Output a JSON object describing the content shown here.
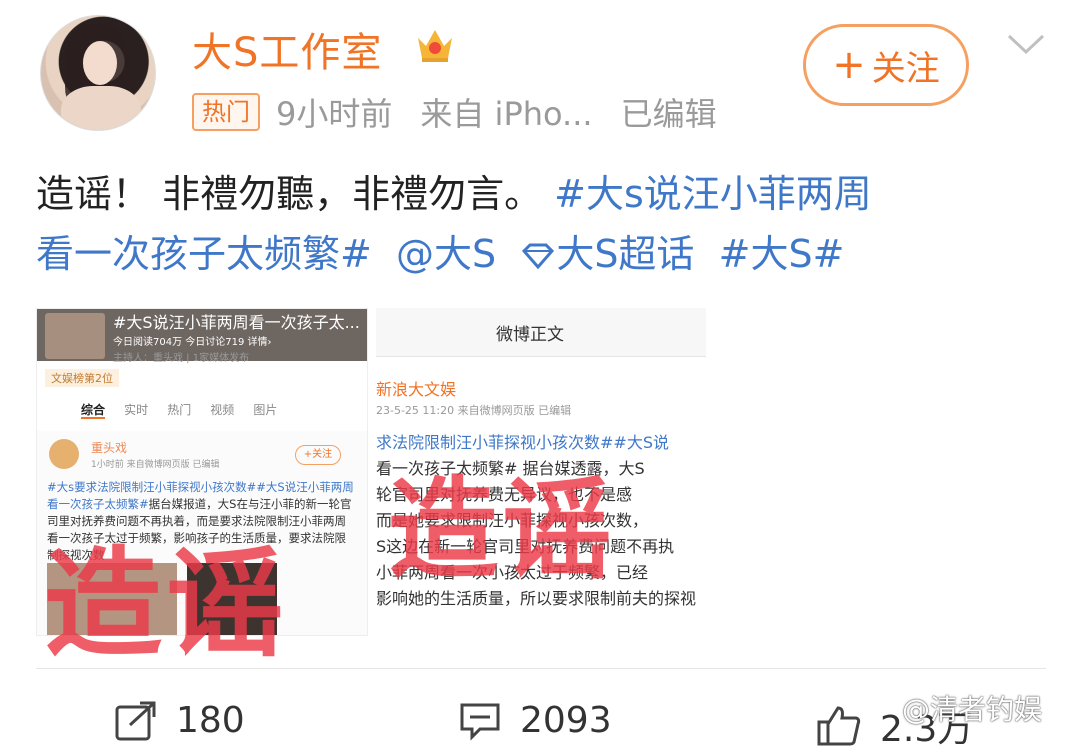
{
  "post": {
    "username": "大S工作室",
    "follow_label": "关注",
    "hot_badge": "热门",
    "time": "9小时前",
    "source": "来自 iPho...",
    "edited": "已编辑",
    "text_plain": "造谣！ 非禮勿聽，非禮勿言。 ",
    "text_tag1_a": "#大s说汪小菲两周",
    "text_tag1_b": "看一次孩子太频繁#",
    "mention": "@大S",
    "supertopic": "大S超话",
    "tag2": "#大S#"
  },
  "image_left": {
    "banner_title": "#大S说汪小菲两周看一次孩子太...",
    "banner_stats": "今日阅读704万  今日讨论719  详情›",
    "host": "主持人：重头戏 | 1家媒体发布",
    "rank": "文娱榜第2位",
    "tabs": [
      "综合",
      "实时",
      "热门",
      "视频",
      "图片"
    ],
    "author": "重头戏",
    "author_meta": "1小时前 来自微博网页版 已编辑",
    "follow": "+关注",
    "body_tags": "#大s要求法院限制汪小菲探视小孩次数##大S说汪小菲两周看一次孩子太频繁#",
    "body_text": "据台媒报道，大S在与汪小菲的新一轮官司里对抚养费问题不再执着，而是要求法院限制汪小菲两周看一次孩子太过于频繁，影响孩子的生活质量，要求法院限制探视次数",
    "stamp": "造谣"
  },
  "image_right": {
    "header": "微博正文",
    "author": "新浪大文娱",
    "meta": "23-5-25 11:20  来自微博网页版  已编辑",
    "body_lines": [
      "求法院限制汪小菲探视小孩次数##大S说",
      "看一次孩子太频繁# 据台媒透露，大S",
      "轮官司里对抚养费无异议，也不是感",
      "而是她要求限制汪小菲探视小孩次数，",
      "S这边在新一轮官司里对抚养费问题不再执",
      "小菲两周看一次小孩太过于频繁，已经",
      "影响她的生活质量，所以要求限制前夫的探视"
    ],
    "stamp": "造谣"
  },
  "actions": {
    "repost_count": "180",
    "comment_count": "2093",
    "like_count": "2.3万"
  },
  "watermark": "@清者钓娱",
  "colors": {
    "brand_orange": "#f07326",
    "link_blue": "#3f78c9",
    "stamp_red": "#ec3a48"
  }
}
